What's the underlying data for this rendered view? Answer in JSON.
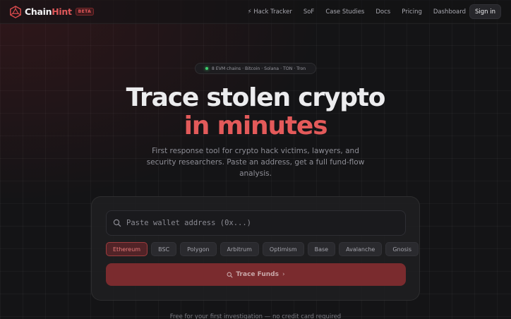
{
  "brand": {
    "name_part1": "Chain",
    "name_part2": "Hint",
    "badge": "BETA",
    "accent": "#e0585a"
  },
  "nav": {
    "links": [
      "⚡ Hack Tracker",
      "SoF",
      "Case Studies",
      "Docs",
      "Pricing",
      "Dashboard"
    ],
    "signin": "Sign in"
  },
  "hero": {
    "pill": "8 EVM chains · Bitcoin · Solana · TON · Tron",
    "headline_line1": "Trace stolen crypto",
    "headline_line2": "in minutes",
    "subtitle": "First response tool for crypto hack victims, lawyers, and security researchers. Paste an address, get a full fund-flow analysis."
  },
  "search": {
    "placeholder": "Paste wallet address (0x...)",
    "value": "",
    "chains": [
      "Ethereum",
      "BSC",
      "Polygon",
      "Arbitrum",
      "Optimism",
      "Base",
      "Avalanche",
      "Gnosis"
    ],
    "selected_chain": "Ethereum",
    "button": "Trace Funds",
    "button_arrow": "›"
  },
  "footer_note": "Free for your first investigation — no credit card required"
}
